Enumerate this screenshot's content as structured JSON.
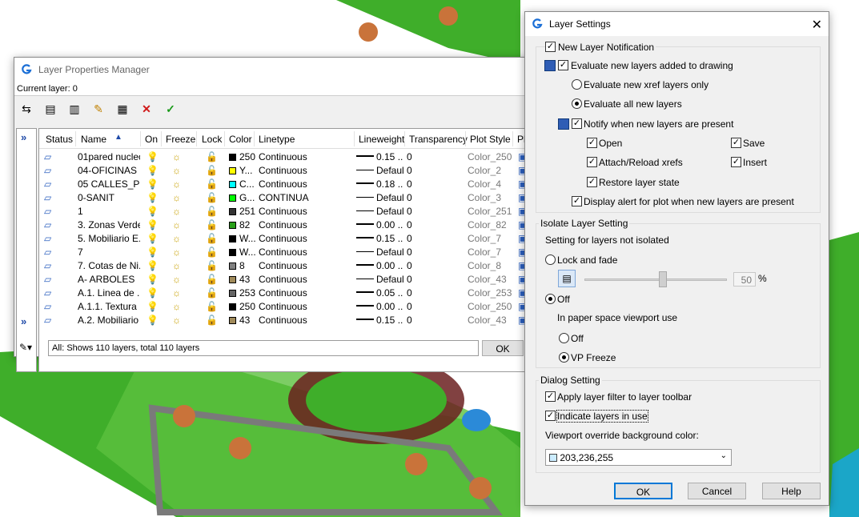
{
  "lpm": {
    "title": "Layer Properties Manager",
    "current_layer": "Current layer: 0",
    "columns": [
      "Status",
      "Name",
      "On",
      "Freeze",
      "Lock",
      "Color",
      "Linetype",
      "Lineweight",
      "Transparency",
      "Plot Style",
      "Pl"
    ],
    "rows": [
      {
        "name": "01pared nucleo",
        "color": "250",
        "color_hex": "#000000",
        "linetype": "Continuous",
        "lineweight": "0.15 ...",
        "transparency": "0",
        "plot_style": "Color_250"
      },
      {
        "name": "04-OFICINAS",
        "color": "Y...",
        "color_hex": "#ffff00",
        "linetype": "Continuous",
        "lineweight": "Default",
        "transparency": "0",
        "plot_style": "Color_2"
      },
      {
        "name": "05 CALLES_PI...",
        "color": "C...",
        "color_hex": "#00ffff",
        "linetype": "Continuous",
        "lineweight": "0.18 ...",
        "transparency": "0",
        "plot_style": "Color_4"
      },
      {
        "name": "0-SANIT",
        "color": "G...",
        "color_hex": "#00ff00",
        "linetype": "CONTINUA",
        "lineweight": "Default",
        "transparency": "0",
        "plot_style": "Color_3"
      },
      {
        "name": "1",
        "color": "251",
        "color_hex": "#333333",
        "linetype": "Continuous",
        "lineweight": "Default",
        "transparency": "0",
        "plot_style": "Color_251"
      },
      {
        "name": "3. Zonas Verdes",
        "color": "82",
        "color_hex": "#2aa01a",
        "linetype": "Continuous",
        "lineweight": "0.00 ...",
        "transparency": "0",
        "plot_style": "Color_82"
      },
      {
        "name": "5. Mobiliario E...",
        "color": "W...",
        "color_hex": "#000000",
        "linetype": "Continuous",
        "lineweight": "0.15 ...",
        "transparency": "0",
        "plot_style": "Color_7"
      },
      {
        "name": "7",
        "color": "W...",
        "color_hex": "#000000",
        "linetype": "Continuous",
        "lineweight": "Default",
        "transparency": "0",
        "plot_style": "Color_7"
      },
      {
        "name": "7. Cotas de Ni...",
        "color": "8",
        "color_hex": "#808080",
        "linetype": "Continuous",
        "lineweight": "0.00 ...",
        "transparency": "0",
        "plot_style": "Color_8"
      },
      {
        "name": "A- ARBOLES",
        "color": "43",
        "color_hex": "#a08a5a",
        "linetype": "Continuous",
        "lineweight": "Default",
        "transparency": "0",
        "plot_style": "Color_43"
      },
      {
        "name": "A.1. Linea de ...",
        "color": "253",
        "color_hex": "#646464",
        "linetype": "Continuous",
        "lineweight": "0.05 ...",
        "transparency": "0",
        "plot_style": "Color_253"
      },
      {
        "name": "A.1.1. Textura",
        "color": "250",
        "color_hex": "#000000",
        "linetype": "Continuous",
        "lineweight": "0.00 ...",
        "transparency": "0",
        "plot_style": "Color_250"
      },
      {
        "name": "A.2. Mobiliario ...",
        "color": "43",
        "color_hex": "#a08a5a",
        "linetype": "Continuous",
        "lineweight": "0.15 ...",
        "transparency": "0",
        "plot_style": "Color_43"
      }
    ],
    "status_text": "All: Shows 110 layers, total 110 layers",
    "ok": "OK"
  },
  "ls": {
    "title": "Layer Settings",
    "new_layer_notification": "New Layer Notification",
    "evaluate_new": "Evaluate new layers added to drawing",
    "eval_xref": "Evaluate new xref layers only",
    "eval_all": "Evaluate all new layers",
    "notify": "Notify when new layers are present",
    "open": "Open",
    "save": "Save",
    "attach": "Attach/Reload xrefs",
    "insert": "Insert",
    "restore": "Restore layer state",
    "display_alert": "Display alert for plot when new layers are present",
    "isolate_group": "Isolate Layer Setting",
    "setting_not_isolated": "Setting for layers not isolated",
    "lock_fade": "Lock and fade",
    "fade_value": "50",
    "pct": "%",
    "off": "Off",
    "paper_space": "In paper space viewport use",
    "off2": "Off",
    "vp_freeze": "VP Freeze",
    "dialog_group": "Dialog Setting",
    "apply_filter": "Apply layer filter to layer toolbar",
    "indicate": "Indicate layers in use",
    "vp_override": "Viewport override background color:",
    "bg_color": "203,236,255",
    "ok": "OK",
    "cancel": "Cancel",
    "help": "Help"
  }
}
